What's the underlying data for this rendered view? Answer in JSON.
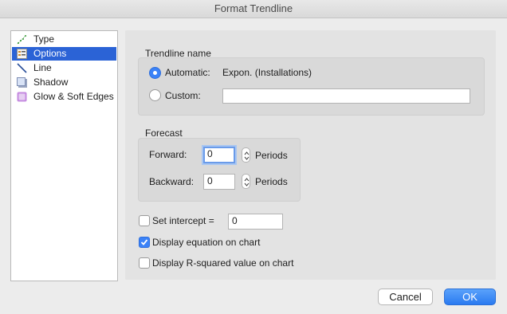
{
  "window": {
    "title": "Format Trendline"
  },
  "sidebar": {
    "items": [
      {
        "label": "Type",
        "icon": "trendline-type-icon",
        "selected": false
      },
      {
        "label": "Options",
        "icon": "options-list-icon",
        "selected": true
      },
      {
        "label": "Line",
        "icon": "line-icon",
        "selected": false
      },
      {
        "label": "Shadow",
        "icon": "shadow-icon",
        "selected": false
      },
      {
        "label": "Glow & Soft Edges",
        "icon": "glow-icon",
        "selected": false
      }
    ]
  },
  "trendline_name": {
    "heading": "Trendline name",
    "automatic_label": "Automatic:",
    "automatic_value": "Expon. (Installations)",
    "automatic_selected": true,
    "custom_label": "Custom:",
    "custom_value": ""
  },
  "forecast": {
    "heading": "Forecast",
    "forward_label": "Forward:",
    "forward_value": "0",
    "backward_label": "Backward:",
    "backward_value": "0",
    "periods_label": "Periods"
  },
  "options": {
    "set_intercept_label": "Set intercept =",
    "set_intercept_checked": false,
    "intercept_value": "0",
    "display_equation_label": "Display equation on chart",
    "display_equation_checked": true,
    "display_rsquared_label": "Display R-squared value on chart",
    "display_rsquared_checked": false
  },
  "buttons": {
    "cancel": "Cancel",
    "ok": "OK"
  },
  "colors": {
    "accent": "#2b63d6",
    "ok_button": "#2a7af0"
  }
}
